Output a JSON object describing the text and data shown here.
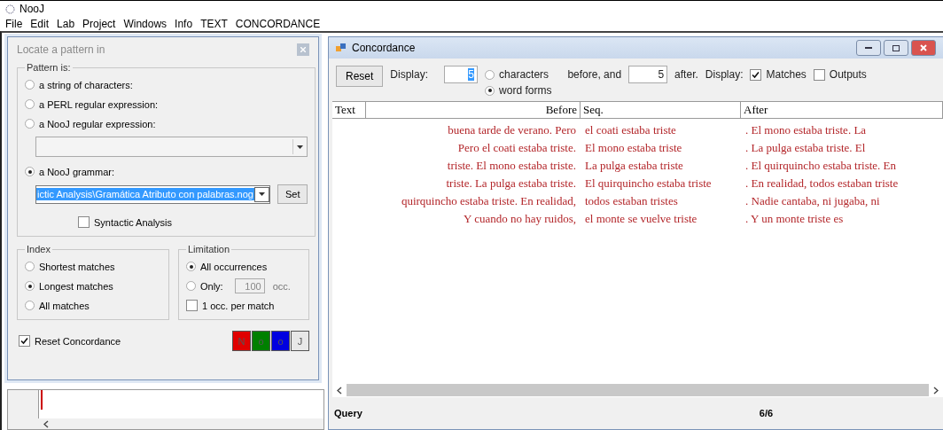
{
  "app": {
    "title": "NooJ",
    "menu": [
      "File",
      "Edit",
      "Lab",
      "Project",
      "Windows",
      "Info",
      "TEXT",
      "CONCORDANCE"
    ]
  },
  "locate_dialog": {
    "title": "Locate a pattern in",
    "pattern_group": {
      "label": "Pattern is:",
      "options": [
        {
          "kind": "plain",
          "label": "a string of characters:",
          "selected": false
        },
        {
          "kind": "plain",
          "label": "a PERL regular expression:",
          "selected": false
        },
        {
          "kind": "combo",
          "label": "a NooJ regular expression:",
          "selected": false
        },
        {
          "kind": "grammar",
          "label": "a NooJ grammar:",
          "selected": true,
          "value": "ictic Analysis\\Gramática Atributo con palabras.nog"
        }
      ],
      "set_button": "Set",
      "syntactic": {
        "label": "Syntactic Analysis",
        "checked": false
      }
    },
    "index_group": {
      "label": "Index",
      "options": [
        {
          "label": "Shortest matches",
          "selected": false
        },
        {
          "label": "Longest matches",
          "selected": true
        },
        {
          "label": "All matches",
          "selected": false
        }
      ]
    },
    "limitation_group": {
      "label": "Limitation",
      "options": [
        {
          "label": "All occurrences",
          "selected": true
        },
        {
          "label": "Only:",
          "selected": false
        }
      ],
      "only_value": "100",
      "only_unit": "occ.",
      "per_match": {
        "label": "1 occ. per match",
        "checked": false
      }
    },
    "reset_concordance": {
      "label": "Reset Concordance",
      "checked": true
    },
    "color_buttons": [
      {
        "label": "N",
        "color": "#e00000"
      },
      {
        "label": "o",
        "color": "#008000"
      },
      {
        "label": "o",
        "color": "#0000e0"
      },
      {
        "label": "J",
        "color": "#e8e8e8"
      }
    ]
  },
  "concordance": {
    "title": "Concordance",
    "toolbar": {
      "reset": "Reset",
      "display_label": "Display:",
      "before_value": "5",
      "units": [
        {
          "label": "characters",
          "selected": false
        },
        {
          "label": "word forms",
          "selected": true
        }
      ],
      "before_and": "before, and",
      "after_value": "5",
      "after_label": "after.",
      "display_label_2": "Display:",
      "checks": [
        {
          "label": "Matches",
          "checked": true
        },
        {
          "label": "Outputs",
          "checked": false
        }
      ]
    },
    "table": {
      "columns": [
        "Text",
        "Before",
        "Seq.",
        "After"
      ],
      "rows": [
        {
          "before": "buena tarde de verano. Pero",
          "seq": "el coati estaba triste",
          "after": ". El mono estaba triste. La"
        },
        {
          "before": "Pero el coati estaba triste.",
          "seq": "El mono estaba triste",
          "after": ". La pulga estaba triste. El"
        },
        {
          "before": "triste. El mono estaba triste.",
          "seq": "La pulga estaba triste",
          "after": ". El quirquincho estaba triste. En"
        },
        {
          "before": "triste. La pulga estaba triste.",
          "seq": "El quirquincho estaba triste",
          "after": ". En realidad, todos estaban triste"
        },
        {
          "before": "quirquincho estaba triste. En realidad,",
          "seq": "todos estaban tristes",
          "after": ". Nadie cantaba, ni jugaba, ni"
        },
        {
          "before": "Y cuando no hay ruidos,",
          "seq": "el monte se vuelve triste",
          "after": ". Y un monte triste es"
        }
      ]
    },
    "status": {
      "label": "Query",
      "count": "6/6"
    }
  }
}
